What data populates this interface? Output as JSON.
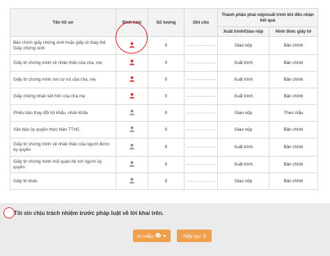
{
  "table": {
    "headers": {
      "name": "Tên hồ sơ",
      "attach": "Đính kèm",
      "qty": "Số lượng",
      "note": "Ghi chú",
      "group": "Thành phần phải nộp/xuất trình khi đến nhận kết quả",
      "submit": "Xuất trình/Giao nộp",
      "form": "Hình thức giấy tờ"
    },
    "rows": [
      {
        "name": "Bản chính giấy chứng sinh hoặc giấy tờ thay thế Giấy chứng sinh",
        "qty": "0",
        "submit": "Giao nộp",
        "form": "Bản chính",
        "attach_color": "#d9262b"
      },
      {
        "name": "Giấy tờ chứng minh về nhân thân của cha, mẹ",
        "qty": "0",
        "submit": "Xuất trình",
        "form": "Bản chính",
        "attach_color": "#d9262b"
      },
      {
        "name": "Giấy tờ chứng minh nơi cư trú của cha, mẹ",
        "qty": "0",
        "submit": "Xuất trình",
        "form": "Bản chính",
        "attach_color": "#d9262b"
      },
      {
        "name": "Giấy chứng nhận kết hôn của cha mẹ",
        "qty": "0",
        "submit": "Xuất trình",
        "form": "Bản chính",
        "attach_color": "#d9262b"
      },
      {
        "name": "Phiếu báo thay đổi hộ khẩu, nhân khẩu",
        "qty": "0",
        "submit": "Giao nộp",
        "form": "Theo mẫu",
        "attach_color": "#888888"
      },
      {
        "name": "Văn bản ủy quyền thực hiện TTHC",
        "qty": "0",
        "submit": "Giao nộp",
        "form": "Bản chính",
        "attach_color": "#888888"
      },
      {
        "name": "Giấy tờ chứng minh về nhân thân của người được ủy quyền",
        "qty": "0",
        "submit": "Xuất trình",
        "form": "Bản chính",
        "attach_color": "#888888"
      },
      {
        "name": "Giấy tờ chứng minh mối quan hệ với người ủy quyền",
        "qty": "0",
        "submit": "Xuất trình",
        "form": "Bản chính",
        "attach_color": "#888888"
      },
      {
        "name": "Giấy tờ khác",
        "qty": "0",
        "submit": "Giao nộp",
        "form": "Bản chính",
        "attach_color": "#888888"
      }
    ]
  },
  "commitment": "Tôi xin chịu trách nhiệm trước pháp luật về lời khai trên.",
  "buttons": {
    "print_label": "In mẫu",
    "print_icon": "printer-icon",
    "next_label": "Tiếp tục",
    "next_icon": "chevron-right-icon"
  },
  "colors": {
    "accent": "#f0a04b",
    "highlight": "#d9262b"
  }
}
